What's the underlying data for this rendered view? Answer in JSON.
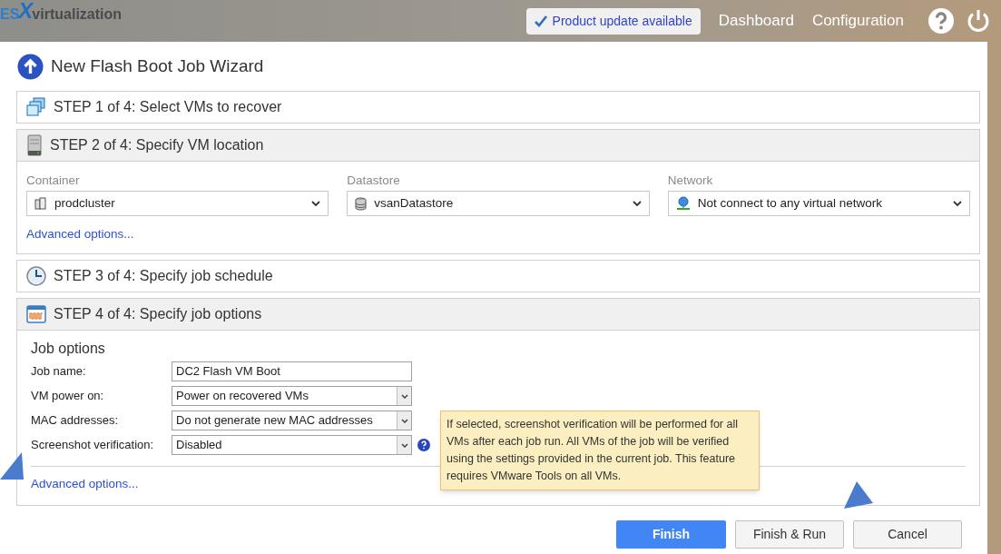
{
  "logo": {
    "prefix": "ES",
    "letter": "X",
    "suffix": "virtualization"
  },
  "top_bar": {
    "update_notice": "Product update available",
    "nav": [
      "Dashboard",
      "Configuration"
    ]
  },
  "wizard": {
    "title": "New Flash Boot Job Wizard",
    "steps": [
      {
        "kind": "vms",
        "label": "STEP 1 of 4: Select VMs to recover",
        "expanded": false
      },
      {
        "kind": "location",
        "label": "STEP 2 of 4: Specify VM location",
        "expanded": true,
        "fields": [
          {
            "kind": "cluster",
            "label": "Container",
            "value": "prodcluster"
          },
          {
            "kind": "datastore",
            "label": "Datastore",
            "value": "vsanDatastore"
          },
          {
            "kind": "network",
            "label": "Network",
            "value": "Not connect to any virtual network"
          }
        ],
        "link": "Advanced options..."
      },
      {
        "kind": "schedule",
        "label": "STEP 3 of 4: Specify job schedule",
        "expanded": false
      },
      {
        "kind": "options",
        "label": "STEP 4 of 4: Specify job options",
        "expanded": true,
        "section_title": "Job options",
        "rows": [
          {
            "kind": "text",
            "label": "Job name:",
            "value": "DC2 Flash VM Boot"
          },
          {
            "kind": "select",
            "label": "VM power on:",
            "value": "Power on recovered VMs"
          },
          {
            "kind": "select",
            "label": "MAC addresses:",
            "value": "Do not generate new MAC addresses"
          },
          {
            "kind": "select",
            "label": "Screenshot verification:",
            "value": "Disabled",
            "help": true
          }
        ],
        "tooltip": "If selected, screenshot verification will be performed for all VMs after each job run. All VMs of the job will be verified using the settings provided in the current job. This feature requires VMware Tools on all VMs.",
        "link": "Advanced options..."
      }
    ],
    "buttons": [
      {
        "label": "Finish",
        "kind": "primary"
      },
      {
        "label": "Finish & Run",
        "kind": "default"
      },
      {
        "label": "Cancel",
        "kind": "default"
      }
    ]
  }
}
